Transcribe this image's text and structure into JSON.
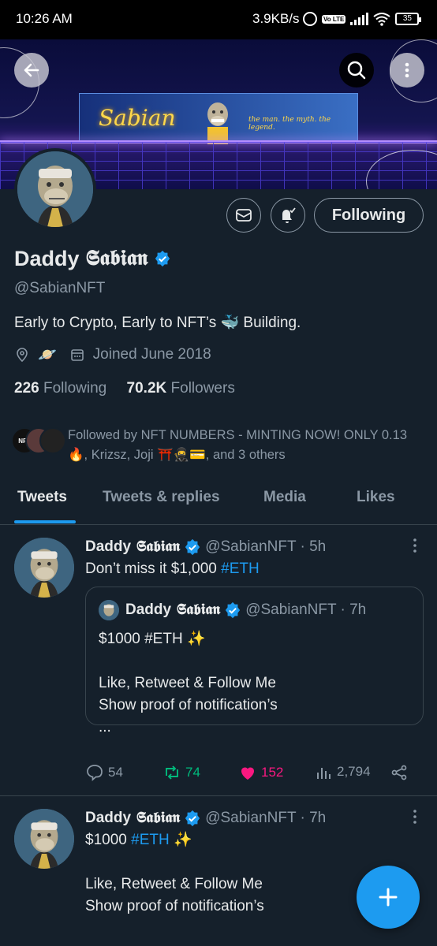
{
  "status_bar": {
    "time": "10:26 AM",
    "network_speed": "3.9KB/s",
    "volte": "Vo LTE",
    "battery": "35"
  },
  "banner": {
    "neon_text": "Sabian",
    "tagline": "the man. the myth. the legend."
  },
  "profile": {
    "display_name_part1": "Daddy",
    "display_name_part2": "𝕾𝖆𝖇𝖎𝖆𝖓",
    "handle": "@SabianNFT",
    "bio": "Early to Crypto, Early to NFT’s 🐳 Building.",
    "location_emoji": "🪐",
    "joined": "Joined June 2018",
    "following_count": "226",
    "following_label": "Following",
    "followers_count": "70.2K",
    "followers_label": "Followers",
    "follow_button": "Following",
    "followed_by": "Followed by NFT NUMBERS - MINTING NOW! ONLY 0.13🔥, Krizsz, Joji ⛩️🥷💳, and 3 others",
    "followed_avatar_text": "NFT"
  },
  "tabs": [
    {
      "label": "Tweets"
    },
    {
      "label": "Tweets & replies"
    },
    {
      "label": "Media"
    },
    {
      "label": "Likes"
    }
  ],
  "tweets": [
    {
      "name_part1": "Daddy",
      "name_part2": "𝕾𝖆𝖇𝖎𝖆𝖓",
      "handle_time": "@SabianNFT · 5h",
      "text_before": "Don’t miss it $1,000 ",
      "hashtag": "#ETH",
      "quote": {
        "name_part1": "Daddy",
        "name_part2": "𝕾𝖆𝖇𝖎𝖆𝖓",
        "handle_time": "@SabianNFT · 7h",
        "line1": "$1000 #ETH ✨",
        "line2": "",
        "line3": "Like, Retweet & Follow Me",
        "line4": "Show proof of notification’s",
        "line5": "..."
      },
      "replies": "54",
      "retweets": "74",
      "likes": "152",
      "views": "2,794"
    },
    {
      "name_part1": "Daddy",
      "name_part2": "𝕾𝖆𝖇𝖎𝖆𝖓",
      "handle_time": "@SabianNFT · 7h",
      "text_before": "$1000 ",
      "hashtag": "#ETH",
      "text_after": " ✨",
      "line3": "Like, Retweet & Follow Me",
      "line4": "Show proof of notification’s"
    }
  ],
  "colors": {
    "accent": "#1d9bf0",
    "background": "#15202b",
    "retweet": "#00ba7c",
    "like": "#f91880",
    "muted": "#8b98a5"
  }
}
